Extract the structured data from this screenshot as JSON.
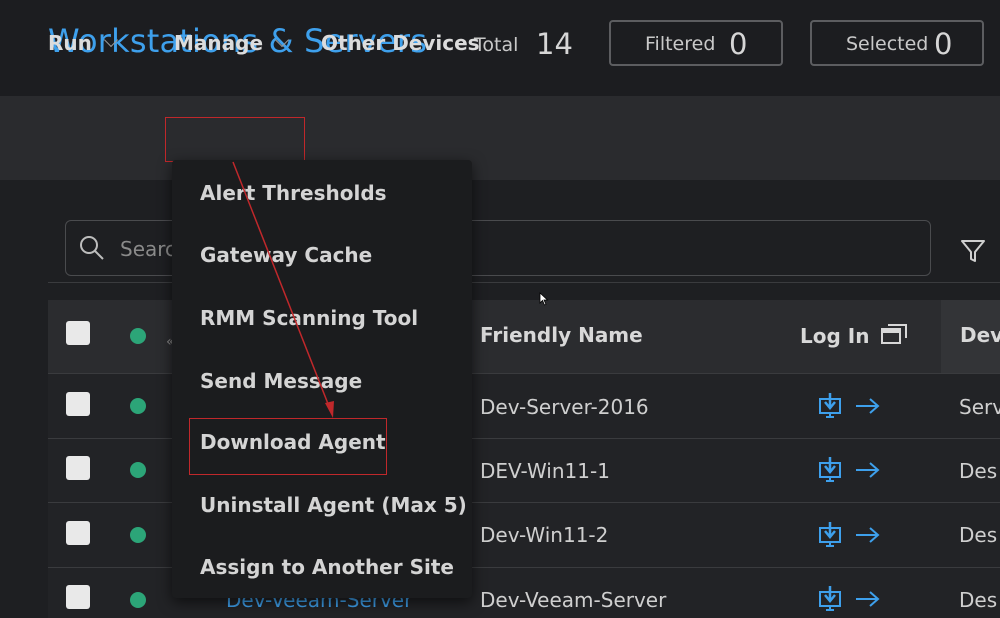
{
  "header": {
    "title": "Workstations & Servers",
    "total_label": "Total",
    "total_value": "14",
    "filtered_label": "Filtered",
    "filtered_value": "0",
    "selected_label": "Selected",
    "selected_value": "0"
  },
  "toolbar": {
    "run_label": "Run",
    "manage_label": "Manage",
    "other_devices_label": "Other Devices"
  },
  "search": {
    "placeholder": "Search"
  },
  "manage_menu": {
    "items": [
      "Alert Thresholds",
      "Gateway Cache",
      "RMM Scanning Tool",
      "Send Message",
      "Download Agent",
      "Uninstall Agent (Max 5)",
      "Assign to Another Site"
    ],
    "highlighted_item": "Download Agent"
  },
  "table": {
    "columns": {
      "friendly_name": "Friendly Name",
      "log_in": "Log In",
      "device_type": "Dev"
    },
    "rows": [
      {
        "name": "",
        "friendly_name": "Dev-Server-2016",
        "type": "Serv"
      },
      {
        "name": "",
        "friendly_name": "DEV-Win11-1",
        "type": "Des"
      },
      {
        "name": "",
        "friendly_name": "Dev-Win11-2",
        "type": "Des"
      },
      {
        "name": "Dev-Veeam-Server",
        "friendly_name": "Dev-Veeam-Server",
        "type": "Des"
      }
    ]
  },
  "icons": {
    "search": "search-icon",
    "filter": "filter-icon",
    "popout": "popout-window-icon",
    "remote_download": "remote-download-icon",
    "arrow_right": "arrow-right-icon"
  },
  "colors": {
    "accent": "#3ea0ec",
    "online": "#2ca578",
    "annotation": "#c0282b"
  }
}
